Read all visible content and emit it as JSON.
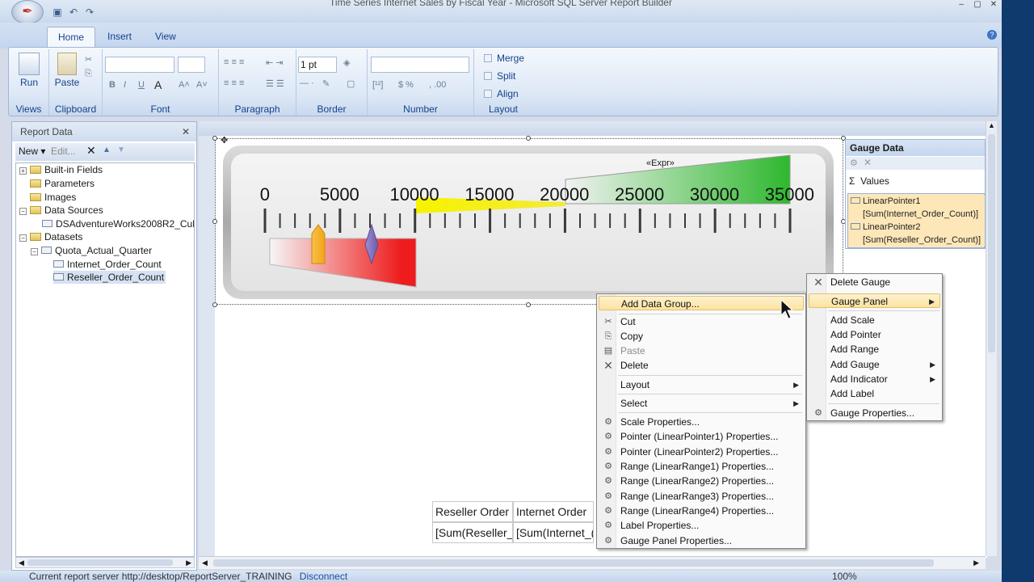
{
  "window": {
    "title": "Time Series Internet Sales by Fiscal Year - Microsoft SQL Server Report Builder",
    "controls": [
      "–",
      "▢",
      "✕"
    ]
  },
  "tabs": [
    {
      "label": "Home",
      "active": true
    },
    {
      "label": "Insert",
      "active": false
    },
    {
      "label": "View",
      "active": false
    }
  ],
  "ribbon": {
    "groups": {
      "views": "Views",
      "clipboard": "Clipboard",
      "font": "Font",
      "paragraph": "Paragraph",
      "border": "Border",
      "number": "Number",
      "layout": "Layout"
    },
    "run_label": "Run",
    "paste_label": "Paste",
    "border_width": "1 pt",
    "merge_label": "Merge",
    "split_label": "Split",
    "align_label": "Align"
  },
  "report_data": {
    "title": "Report Data",
    "close": "✕",
    "toolbar": {
      "new_label": "New",
      "edit_label": "Edit..."
    },
    "tree": [
      {
        "label": "Built-in Fields",
        "type": "folder",
        "level": 0
      },
      {
        "label": "Parameters",
        "type": "folder",
        "level": 0
      },
      {
        "label": "Images",
        "type": "folder",
        "level": 0
      },
      {
        "label": "Data Sources",
        "type": "folder",
        "level": 0
      },
      {
        "label": "DSAdventureWorks2008R2_Cub",
        "type": "datasource",
        "level": 1
      },
      {
        "label": "Datasets",
        "type": "folder",
        "level": 0
      },
      {
        "label": "Quota_Actual_Quarter",
        "type": "dataset",
        "level": 1
      },
      {
        "label": "Internet_Order_Count",
        "type": "field",
        "level": 2
      },
      {
        "label": "Reseller_Order_Count",
        "type": "field",
        "level": 2,
        "selected": true
      }
    ]
  },
  "gauge": {
    "scale_labels": [
      "0",
      "5000",
      "10000",
      "15000",
      "20000",
      "25000",
      "30000",
      "35000"
    ],
    "expr_label": "«Expr»"
  },
  "gauge_data": {
    "title": "Gauge Data",
    "values_label": "Values",
    "rows": [
      "LinearPointer1",
      "[Sum(Internet_Order_Count)]",
      "LinearPointer2",
      "[Sum(Reseller_Order_Count)]"
    ]
  },
  "context_menu": {
    "items": [
      "Add Data Group...",
      "Cut",
      "Copy",
      "Paste",
      "Delete",
      "Layout",
      "Select",
      "Scale Properties...",
      "Pointer (LinearPointer1) Properties...",
      "Pointer (LinearPointer2) Properties...",
      "Range (LinearRange1) Properties...",
      "Range (LinearRange2) Properties...",
      "Range (LinearRange3) Properties...",
      "Range (LinearRange4) Properties...",
      "Label Properties...",
      "Gauge Panel Properties..."
    ]
  },
  "submenu": {
    "items": [
      "Delete Gauge",
      "Gauge Panel",
      "Add Scale",
      "Add Pointer",
      "Add Range",
      "Add Gauge",
      "Add Indicator",
      "Add Label",
      "Gauge Properties..."
    ]
  },
  "table": {
    "headers": [
      "Reseller Order",
      "Internet Order"
    ],
    "cells": [
      "[Sum(Reseller_",
      "[Sum(Internet_("
    ]
  },
  "status": {
    "text": "Current report server http://desktop/ReportServer_TRAINING",
    "link": "Disconnect",
    "zoom": "100%"
  }
}
